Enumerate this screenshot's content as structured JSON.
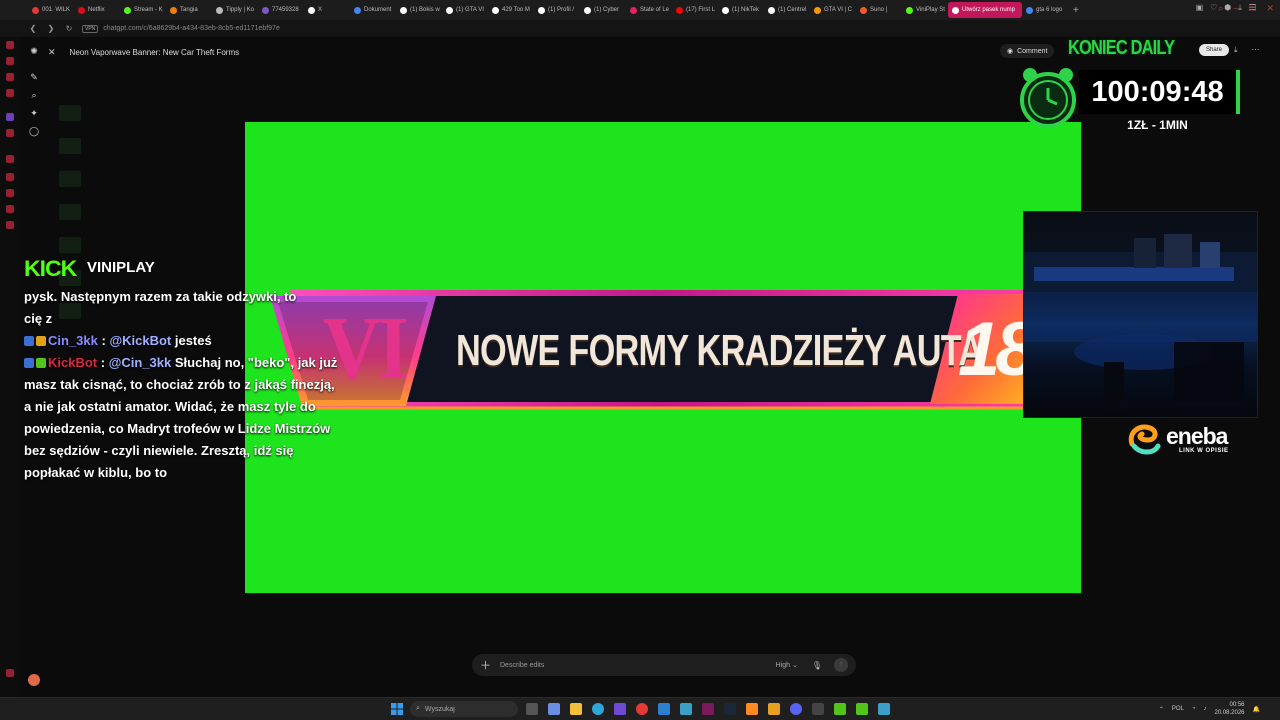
{
  "browser": {
    "tabs": [
      {
        "label": "001. WILK",
        "color": "#e53935"
      },
      {
        "label": "Netflix",
        "color": "#e50914"
      },
      {
        "label": "Stream - K",
        "color": "#53fc18"
      },
      {
        "label": "Tangia",
        "color": "#f57c00"
      },
      {
        "label": "Tipply | Ko",
        "color": "#bbbbbb"
      },
      {
        "label": "77459328",
        "color": "#7e57c2"
      },
      {
        "label": "X",
        "color": "#ffffff"
      },
      {
        "label": "Dokument",
        "color": "#4285f4"
      },
      {
        "label": "(1) Bokis w",
        "color": "#ffffff"
      },
      {
        "label": "(1) GTA VI",
        "color": "#ffffff"
      },
      {
        "label": "429 Too M",
        "color": "#ffffff"
      },
      {
        "label": "(1) Profil /",
        "color": "#ffffff"
      },
      {
        "label": "(1) Cyber",
        "color": "#ffffff"
      },
      {
        "label": "State of Le",
        "color": "#e91e63"
      },
      {
        "label": "(17) First L",
        "color": "#ff0000"
      },
      {
        "label": "(1) NikTek",
        "color": "#ffffff"
      },
      {
        "label": "(1) Centrel",
        "color": "#ffffff"
      },
      {
        "label": "GTA VI | C",
        "color": "#ff9800"
      },
      {
        "label": "Suno |",
        "color": "#ff5722"
      },
      {
        "label": "ViniPlay St",
        "color": "#53fc18"
      },
      {
        "label": "Utwórz pasek nump",
        "color": "#ffffff",
        "active": true
      },
      {
        "label": "gta 6 logo",
        "color": "#4285f4"
      }
    ],
    "new_tab": "+",
    "url": "chatgpt.com/c/6a8629b4-a434-83eb-8cb5-ed1171ebf97e",
    "vpn_label": "VPN"
  },
  "chatgpt": {
    "conversation_title": "Neon Vaporwave Banner: New Car Theft Forms",
    "comment_label": "Comment",
    "share_label": "Share",
    "input_placeholder": "Describe edits",
    "quality_label": "High"
  },
  "banner": {
    "text": "NOWE FORMY KRADZIEŻY AUTA",
    "logo_text": "VI",
    "age_text": "18"
  },
  "overlay": {
    "koniec_label": "KONIEC DAILY",
    "timer": "100:09:48",
    "rate": "1ZŁ - 1MIN",
    "sponsor_name": "eneba",
    "sponsor_sub": "LINK W OPISIE"
  },
  "chat": {
    "platform": "KICK",
    "channel": "VINIPLAY",
    "lines": [
      {
        "text": "pysk. Następnym razem za takie odzywki, to"
      },
      {
        "text": "cię z"
      },
      {
        "user": "Cin_3kk",
        "sep": " : ",
        "mention": "@KickBot",
        "text": " jesteś"
      },
      {
        "user": "KickBot",
        "sep": " : ",
        "mention": "@Cin_3kk",
        "text": " Słuchaj no, \"beko\", jak już masz tak cisnąć, to chociaż zrób to z jakąś finezją, a nie jak ostatni amator. Widać, że masz tyle do powiedzenia, co Madryt trofeów w Lidze Mistrzów bez sędziów - czyli niewiele. Zresztą, idź się popłakać w kiblu, bo to"
      }
    ]
  },
  "taskbar": {
    "search_placeholder": "Wyszukaj",
    "language": "POL",
    "time": "00:56",
    "date": "20.08.2026"
  }
}
